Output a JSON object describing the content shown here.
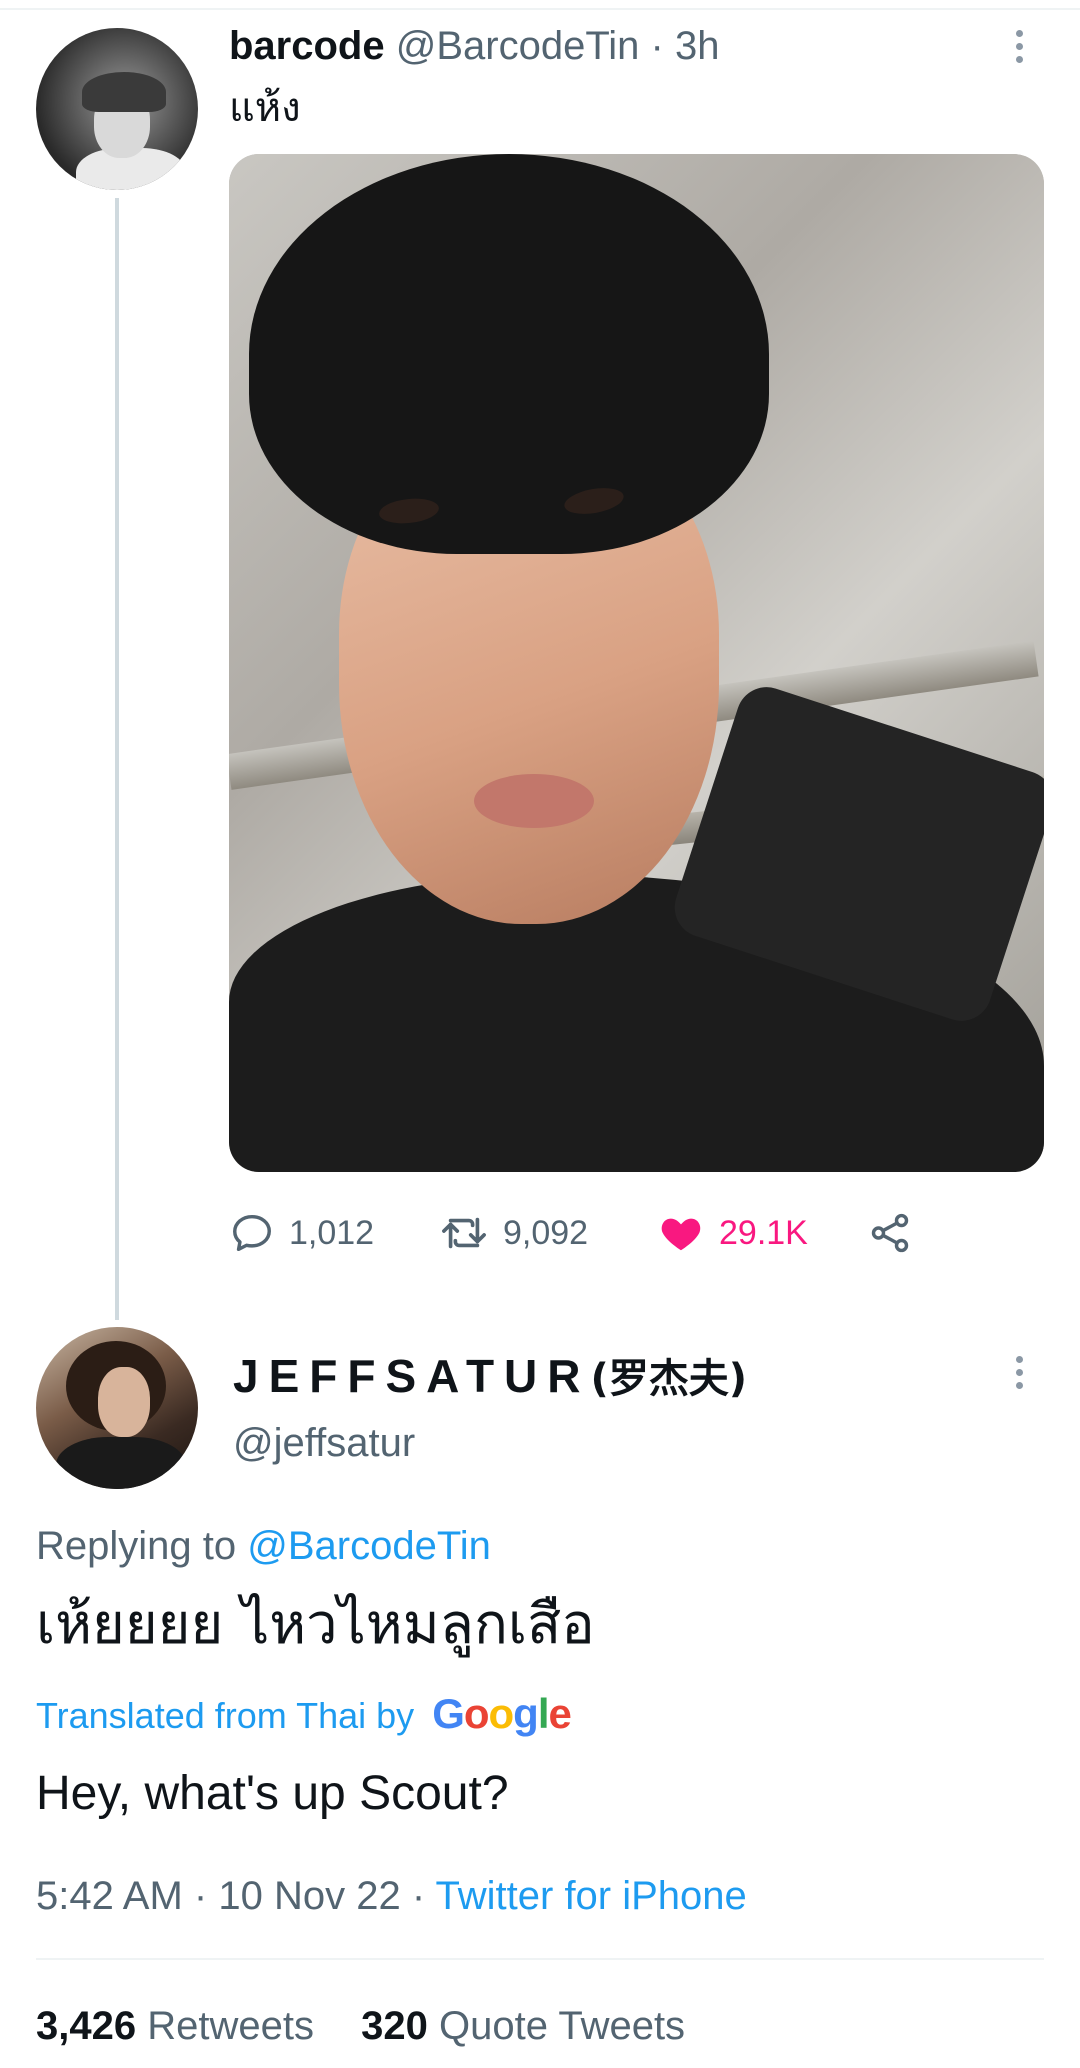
{
  "colors": {
    "text_primary": "#0f1419",
    "text_secondary": "#536471",
    "link_blue": "#1d9bf0",
    "like_pink": "#f91880",
    "divider": "#eff3f4"
  },
  "tweet": {
    "author_name": "barcode",
    "author_handle": "@BarcodeTin",
    "separator": "·",
    "time": "3h",
    "text": "แห้ง",
    "media": "photo",
    "actions": {
      "reply": {
        "icon": "reply-icon",
        "count": "1,012"
      },
      "retweet": {
        "icon": "retweet-icon",
        "count": "9,092"
      },
      "like": {
        "icon": "heart-filled-icon",
        "count": "29.1K",
        "liked": true
      },
      "share": {
        "icon": "share-icon"
      }
    }
  },
  "reply": {
    "author_name": "JEFFSATUR",
    "author_name_suffix": "(罗杰夫)",
    "author_handle": "@jeffsatur",
    "replying_prefix": "Replying to",
    "replying_to": "@BarcodeTin",
    "text": "เห้ยยยย ไหวไหมลูกเสือ",
    "translated_label": "Translated from Thai by",
    "translation_provider": "Google",
    "translation": "Hey, what's up Scout?",
    "time": "5:42 AM",
    "date": "10 Nov 22",
    "separator": "·",
    "source": "Twitter for iPhone",
    "stats": {
      "retweets_count": "3,426",
      "retweets_label": "Retweets",
      "quotes_count": "320",
      "quotes_label": "Quote Tweets"
    }
  }
}
